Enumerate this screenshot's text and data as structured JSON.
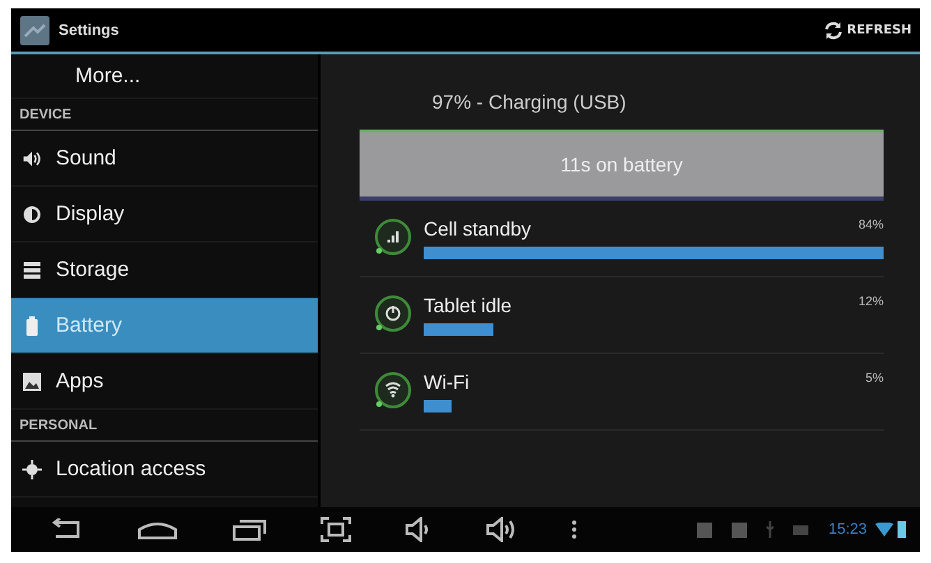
{
  "action_bar": {
    "title": "Settings",
    "action": "REFRESH"
  },
  "sidebar": {
    "items": [
      {
        "kind": "item",
        "label": "More...",
        "selected": false
      },
      {
        "kind": "header",
        "label": "DEVICE"
      },
      {
        "kind": "item",
        "label": "Sound",
        "selected": false
      },
      {
        "kind": "item",
        "label": "Display",
        "selected": false
      },
      {
        "kind": "item",
        "label": "Storage",
        "selected": false
      },
      {
        "kind": "item",
        "label": "Battery",
        "selected": true
      },
      {
        "kind": "item",
        "label": "Apps",
        "selected": false
      },
      {
        "kind": "header",
        "label": "PERSONAL"
      },
      {
        "kind": "item",
        "label": "Location access",
        "selected": false
      }
    ]
  },
  "battery": {
    "status": "97% - Charging (USB)",
    "graph_label": "11s on battery",
    "usage": [
      {
        "name": "Cell standby",
        "percent": "84%"
      },
      {
        "name": "Tablet idle",
        "percent": "12%"
      },
      {
        "name": "Wi-Fi",
        "percent": "5%"
      }
    ]
  },
  "status_bar": {
    "time": "15:23"
  }
}
